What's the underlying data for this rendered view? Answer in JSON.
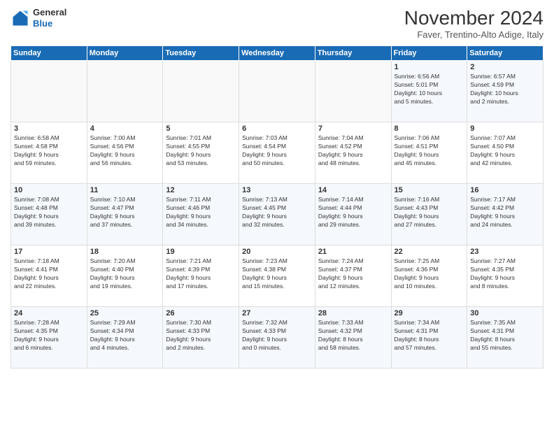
{
  "logo": {
    "line1": "General",
    "line2": "Blue"
  },
  "title": "November 2024",
  "subtitle": "Faver, Trentino-Alto Adige, Italy",
  "days_header": [
    "Sunday",
    "Monday",
    "Tuesday",
    "Wednesday",
    "Thursday",
    "Friday",
    "Saturday"
  ],
  "weeks": [
    [
      {
        "day": "",
        "info": ""
      },
      {
        "day": "",
        "info": ""
      },
      {
        "day": "",
        "info": ""
      },
      {
        "day": "",
        "info": ""
      },
      {
        "day": "",
        "info": ""
      },
      {
        "day": "1",
        "info": "Sunrise: 6:56 AM\nSunset: 5:01 PM\nDaylight: 10 hours\nand 5 minutes."
      },
      {
        "day": "2",
        "info": "Sunrise: 6:57 AM\nSunset: 4:59 PM\nDaylight: 10 hours\nand 2 minutes."
      }
    ],
    [
      {
        "day": "3",
        "info": "Sunrise: 6:58 AM\nSunset: 4:58 PM\nDaylight: 9 hours\nand 59 minutes."
      },
      {
        "day": "4",
        "info": "Sunrise: 7:00 AM\nSunset: 4:56 PM\nDaylight: 9 hours\nand 56 minutes."
      },
      {
        "day": "5",
        "info": "Sunrise: 7:01 AM\nSunset: 4:55 PM\nDaylight: 9 hours\nand 53 minutes."
      },
      {
        "day": "6",
        "info": "Sunrise: 7:03 AM\nSunset: 4:54 PM\nDaylight: 9 hours\nand 50 minutes."
      },
      {
        "day": "7",
        "info": "Sunrise: 7:04 AM\nSunset: 4:52 PM\nDaylight: 9 hours\nand 48 minutes."
      },
      {
        "day": "8",
        "info": "Sunrise: 7:06 AM\nSunset: 4:51 PM\nDaylight: 9 hours\nand 45 minutes."
      },
      {
        "day": "9",
        "info": "Sunrise: 7:07 AM\nSunset: 4:50 PM\nDaylight: 9 hours\nand 42 minutes."
      }
    ],
    [
      {
        "day": "10",
        "info": "Sunrise: 7:08 AM\nSunset: 4:48 PM\nDaylight: 9 hours\nand 39 minutes."
      },
      {
        "day": "11",
        "info": "Sunrise: 7:10 AM\nSunset: 4:47 PM\nDaylight: 9 hours\nand 37 minutes."
      },
      {
        "day": "12",
        "info": "Sunrise: 7:11 AM\nSunset: 4:46 PM\nDaylight: 9 hours\nand 34 minutes."
      },
      {
        "day": "13",
        "info": "Sunrise: 7:13 AM\nSunset: 4:45 PM\nDaylight: 9 hours\nand 32 minutes."
      },
      {
        "day": "14",
        "info": "Sunrise: 7:14 AM\nSunset: 4:44 PM\nDaylight: 9 hours\nand 29 minutes."
      },
      {
        "day": "15",
        "info": "Sunrise: 7:16 AM\nSunset: 4:43 PM\nDaylight: 9 hours\nand 27 minutes."
      },
      {
        "day": "16",
        "info": "Sunrise: 7:17 AM\nSunset: 4:42 PM\nDaylight: 9 hours\nand 24 minutes."
      }
    ],
    [
      {
        "day": "17",
        "info": "Sunrise: 7:18 AM\nSunset: 4:41 PM\nDaylight: 9 hours\nand 22 minutes."
      },
      {
        "day": "18",
        "info": "Sunrise: 7:20 AM\nSunset: 4:40 PM\nDaylight: 9 hours\nand 19 minutes."
      },
      {
        "day": "19",
        "info": "Sunrise: 7:21 AM\nSunset: 4:39 PM\nDaylight: 9 hours\nand 17 minutes."
      },
      {
        "day": "20",
        "info": "Sunrise: 7:23 AM\nSunset: 4:38 PM\nDaylight: 9 hours\nand 15 minutes."
      },
      {
        "day": "21",
        "info": "Sunrise: 7:24 AM\nSunset: 4:37 PM\nDaylight: 9 hours\nand 12 minutes."
      },
      {
        "day": "22",
        "info": "Sunrise: 7:25 AM\nSunset: 4:36 PM\nDaylight: 9 hours\nand 10 minutes."
      },
      {
        "day": "23",
        "info": "Sunrise: 7:27 AM\nSunset: 4:35 PM\nDaylight: 9 hours\nand 8 minutes."
      }
    ],
    [
      {
        "day": "24",
        "info": "Sunrise: 7:28 AM\nSunset: 4:35 PM\nDaylight: 9 hours\nand 6 minutes."
      },
      {
        "day": "25",
        "info": "Sunrise: 7:29 AM\nSunset: 4:34 PM\nDaylight: 9 hours\nand 4 minutes."
      },
      {
        "day": "26",
        "info": "Sunrise: 7:30 AM\nSunset: 4:33 PM\nDaylight: 9 hours\nand 2 minutes."
      },
      {
        "day": "27",
        "info": "Sunrise: 7:32 AM\nSunset: 4:33 PM\nDaylight: 9 hours\nand 0 minutes."
      },
      {
        "day": "28",
        "info": "Sunrise: 7:33 AM\nSunset: 4:32 PM\nDaylight: 8 hours\nand 58 minutes."
      },
      {
        "day": "29",
        "info": "Sunrise: 7:34 AM\nSunset: 4:31 PM\nDaylight: 8 hours\nand 57 minutes."
      },
      {
        "day": "30",
        "info": "Sunrise: 7:35 AM\nSunset: 4:31 PM\nDaylight: 8 hours\nand 55 minutes."
      }
    ]
  ]
}
